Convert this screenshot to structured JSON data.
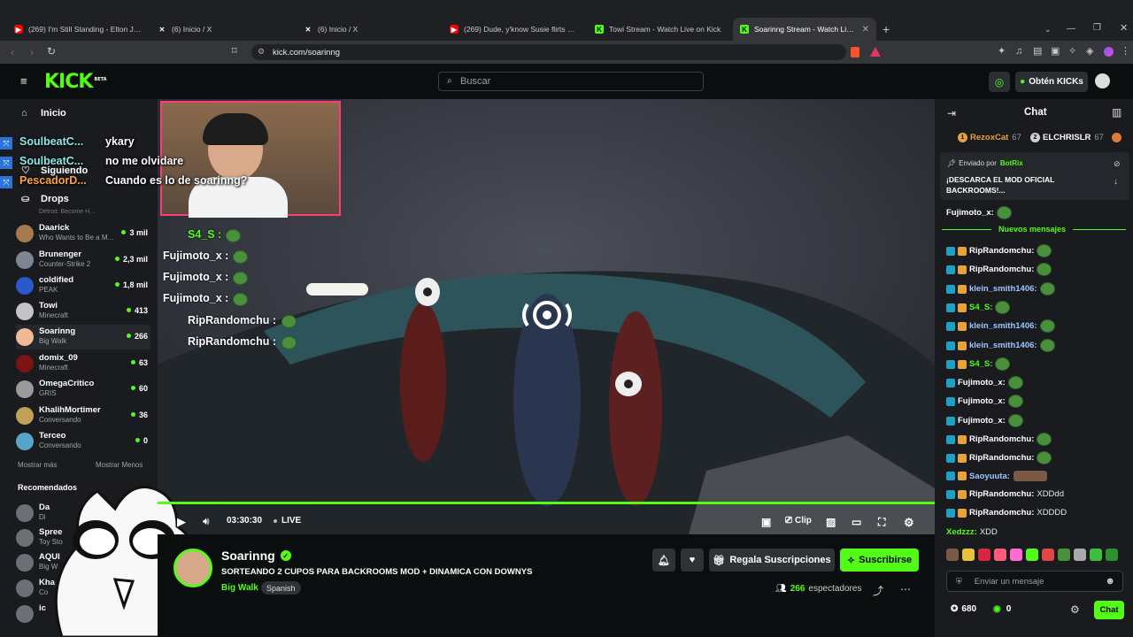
{
  "browser": {
    "tabs": [
      {
        "title": "(269) I'm Still Standing - Elton John s",
        "icon": "youtube-icon"
      },
      {
        "title": "(6) Inicio / X",
        "icon": "x-icon"
      },
      {
        "title": "(6) Inicio / X",
        "icon": "x-icon"
      },
      {
        "title": "(269) Dude, y'know Susie flirts with E",
        "icon": "youtube-icon"
      },
      {
        "title": "Towi Stream - Watch Live on Kick",
        "icon": "kick-icon"
      },
      {
        "title": "Soarinng Stream - Watch Live on",
        "icon": "kick-icon"
      }
    ],
    "url": "kick.com/soarinng"
  },
  "header": {
    "logo": "KICK",
    "logo_sup": "BETA",
    "search_placeholder": "Buscar",
    "get_kicks": "Obtén KICKs"
  },
  "sidebar": {
    "nav": [
      {
        "label": "Inicio",
        "icon": "home-icon"
      },
      {
        "label": "Siguiendo",
        "icon": "heart-icon"
      },
      {
        "label": "Drops",
        "icon": "drops-icon"
      }
    ],
    "cut_text": "Detroit: Become H...",
    "channels": [
      {
        "name": "Daarick",
        "game": "Who Wants to Be a M...",
        "viewers": "3 mil",
        "color": "#a7794e"
      },
      {
        "name": "Brunenger",
        "game": "Counter-Strike 2",
        "viewers": "2,3 mil",
        "color": "#7d8591"
      },
      {
        "name": "coldified",
        "game": "PEAK",
        "viewers": "1,8 mil",
        "color": "#2a57c9"
      },
      {
        "name": "Towi",
        "game": "Minecraft",
        "viewers": "413",
        "color": "#c4c4c4"
      },
      {
        "name": "Soarinng",
        "game": "Big Walk",
        "viewers": "266",
        "color": "#f1b996"
      },
      {
        "name": "domix_09",
        "game": "Minecraft",
        "viewers": "63",
        "color": "#7c1414"
      },
      {
        "name": "OmegaCritico",
        "game": "GRIS",
        "viewers": "60",
        "color": "#9a9a9a"
      },
      {
        "name": "KhalihMortimer",
        "game": "Conversando",
        "viewers": "36",
        "color": "#c1a05a"
      },
      {
        "name": "Terceo",
        "game": "Conversando",
        "viewers": "0",
        "color": "#56a5c9"
      }
    ],
    "show_more": "Mostrar más",
    "show_less": "Mostrar Menos",
    "recommended": "Recomendados",
    "recommended_items": [
      {
        "name": "Da",
        "game": "Di"
      },
      {
        "name": "Spree",
        "game": "Toy Sto"
      },
      {
        "name": "AQUI",
        "game": "Big W"
      },
      {
        "name": "Kha",
        "game": "Co"
      },
      {
        "name": "ic",
        "game": ""
      }
    ]
  },
  "overlay": {
    "side_chat": [
      {
        "user": "SoulbeatC...",
        "text": "ykary"
      },
      {
        "user": "SoulbeatC...",
        "text": "no me olvidare"
      },
      {
        "user": "PescadorD...",
        "text": "Cuando es lo de soarinng?"
      }
    ],
    "stream_chat": [
      {
        "user": "S4_S :",
        "color": "#53fc18"
      },
      {
        "user": "Fujimoto_x :",
        "color": "#ffffff"
      },
      {
        "user": "Fujimoto_x :",
        "color": "#ffffff"
      },
      {
        "user": "Fujimoto_x :",
        "color": "#ffffff"
      },
      {
        "user": "RipRandomchu :",
        "color": "#ffffff"
      },
      {
        "user": "RipRandomchu :",
        "color": "#ffffff"
      }
    ]
  },
  "player": {
    "time": "03:30:30",
    "live": "LIVE",
    "clip": "Clip",
    "progress": 1.0
  },
  "stream": {
    "streamer": "Soarinng",
    "title": "SORTEANDO 2 CUPOS PARA BACKROOMS MOD + DINAMICA CON DOWNYS",
    "category": "Big Walk",
    "language": "Spanish",
    "gift_subs": "Regala Suscripciones",
    "subscribe": "Suscribirse",
    "viewers": "266",
    "viewers_label": "espectadores"
  },
  "chat": {
    "title": "Chat",
    "top_gifters": [
      {
        "rank": "1",
        "name": "RezoxCat",
        "count": "67",
        "color": "#e8a23a"
      },
      {
        "rank": "2",
        "name": "ELCHRISLR",
        "count": "67",
        "color": "#d0d0d0"
      }
    ],
    "pinned_by_label": "Enviado por",
    "pinned_by": "BotRix",
    "pinned_text": "¡DESCARCA EL MOD OFICIAL BACKROOMS!...",
    "first_user": "Fujimoto_x:",
    "new_messages": "Nuevos mensajes",
    "messages": [
      {
        "user": "RipRandomchu:",
        "text": "",
        "style": "u-white",
        "emote": true
      },
      {
        "user": "RipRandomchu:",
        "text": "",
        "style": "u-white",
        "emote": true
      },
      {
        "user": "klein_smith1406:",
        "text": "",
        "style": "u-blue",
        "emote": true
      },
      {
        "user": "S4_S:",
        "text": "",
        "style": "u-green",
        "emote": true
      },
      {
        "user": "klein_smith1406:",
        "text": "",
        "style": "u-blue",
        "emote": true
      },
      {
        "user": "klein_smith1406:",
        "text": "",
        "style": "u-blue",
        "emote": true
      },
      {
        "user": "S4_S:",
        "text": "",
        "style": "u-green",
        "emote": true
      },
      {
        "user": "Fujimoto_x:",
        "text": "",
        "style": "u-white",
        "emote": true
      },
      {
        "user": "Fujimoto_x:",
        "text": "",
        "style": "u-white",
        "emote": true
      },
      {
        "user": "Fujimoto_x:",
        "text": "",
        "style": "u-white",
        "emote": true
      },
      {
        "user": "RipRandomchu:",
        "text": "",
        "style": "u-white",
        "emote": true
      },
      {
        "user": "RipRandomchu:",
        "text": "",
        "style": "u-white",
        "emote": true
      },
      {
        "user": "Saoyuuta:",
        "text": "",
        "style": "u-blue",
        "emote": false
      },
      {
        "user": "RipRandomchu:",
        "text": "XDDdd",
        "style": "u-white",
        "emote": false
      },
      {
        "user": "RipRandomchu:",
        "text": "XDDDD",
        "style": "u-white",
        "emote": false
      },
      {
        "user": "Xedzzz:",
        "text": "XDD",
        "style": "u-green",
        "emote": false
      }
    ],
    "input_placeholder": "Enviar un mensaje",
    "kicks": "680",
    "points": "0",
    "send": "Chat"
  }
}
